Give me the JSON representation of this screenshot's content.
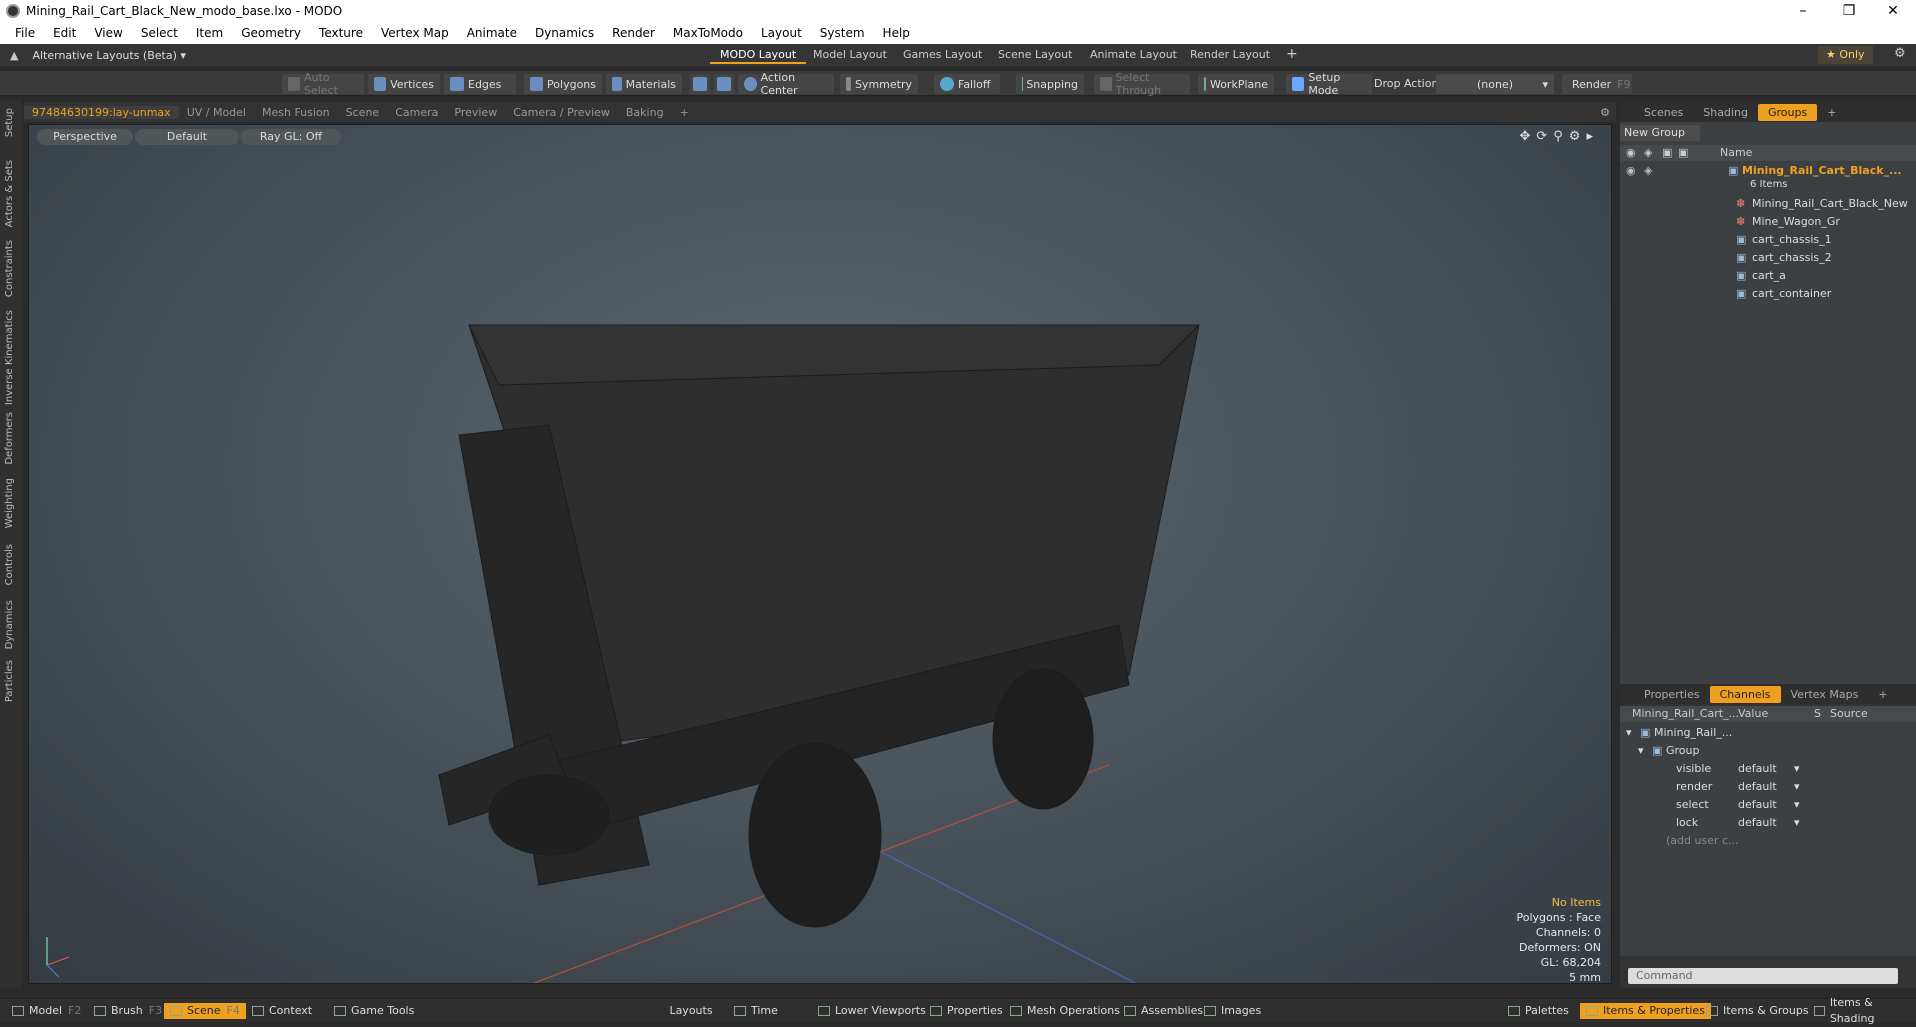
{
  "window": {
    "title": "Mining_Rail_Cart_Black_New_modo_base.lxo - MODO"
  },
  "menu": [
    "File",
    "Edit",
    "View",
    "Select",
    "Item",
    "Geometry",
    "Texture",
    "Vertex Map",
    "Animate",
    "Dynamics",
    "Render",
    "MaxToModo",
    "Layout",
    "System",
    "Help"
  ],
  "layouts": {
    "alt_label": "Alternative Layouts (Beta)",
    "tabs": [
      "MODO Layout",
      "Model Layout",
      "Games Layout",
      "Scene Layout",
      "Animate Layout",
      "Render Layout"
    ],
    "plus": "+",
    "only_label": "Only"
  },
  "toolbar": {
    "auto_select": "Auto Select",
    "vertices": "Vertices",
    "edges": "Edges",
    "polygons": "Polygons",
    "materials": "Materials",
    "action_center": "Action Center",
    "symmetry": "Symmetry",
    "falloff": "Falloff",
    "snapping": "Snapping",
    "select_through": "Select Through",
    "workplane": "WorkPlane",
    "setup_mode": "Setup Mode",
    "drop_action": "Drop Action",
    "drop_value": "(none)",
    "render": "Render",
    "render_key": "F9"
  },
  "left_tabs": [
    "Setup",
    "Actors & Sets",
    "Constraints",
    "Inverse Kinematics",
    "Deformers",
    "Weighting",
    "Controls",
    "Dynamics",
    "Particles"
  ],
  "viewport": {
    "tabs": [
      "97484630199:lay-unmax",
      "UV / Model",
      "Mesh Fusion",
      "Scene",
      "Camera",
      "Preview",
      "Camera / Preview",
      "Baking"
    ],
    "tab_plus": "+",
    "view_mode": "Perspective",
    "shading": "Default",
    "raygl": "Ray GL: Off",
    "info": {
      "no_items": "No Items",
      "polygons": "Polygons : Face",
      "channels": "Channels: 0",
      "deformers": "Deformers: ON",
      "gl": "GL: 68,204",
      "unit": "5 mm"
    }
  },
  "right_top": {
    "tabs": [
      "Scenes",
      "Shading",
      "Groups"
    ],
    "tab_plus": "+",
    "new_group": "New Group",
    "name_col": "Name",
    "group_name": "Mining_Rail_Cart_Black_...",
    "group_count": "6 Items",
    "items": [
      "Mining_Rail_Cart_Black_New",
      "Mine_Wagon_Gr",
      "cart_chassis_1",
      "cart_chassis_2",
      "cart_a",
      "cart_container"
    ]
  },
  "right_bottom": {
    "tabs": [
      "Properties",
      "Channels",
      "Vertex Maps"
    ],
    "tab_plus": "+",
    "cols": [
      "Mining_Rail_Cart_...",
      "Value",
      "S",
      "Source"
    ],
    "root": "Mining_Rail_...",
    "group": "Group",
    "channels": [
      {
        "name": "visible",
        "value": "default"
      },
      {
        "name": "render",
        "value": "default"
      },
      {
        "name": "select",
        "value": "default"
      },
      {
        "name": "lock",
        "value": "default"
      }
    ],
    "add_user": "(add user c...",
    "command_placeholder": "Command"
  },
  "bottom": {
    "left": [
      {
        "label": "Model",
        "key": "F2"
      },
      {
        "label": "Brush",
        "key": "F3"
      },
      {
        "label": "Scene",
        "key": "F4"
      },
      {
        "label": "Context",
        "key": ""
      },
      {
        "label": "Game Tools",
        "key": ""
      }
    ],
    "middle": [
      "Layouts",
      "Time",
      "Lower Viewports",
      "Properties",
      "Mesh Operations",
      "Assemblies",
      "Images"
    ],
    "right": [
      "Palettes",
      "Items & Properties",
      "Items & Groups",
      "Items & Shading"
    ]
  },
  "colors": {
    "accent": "#f0a020",
    "axis_x": "#c0503a",
    "axis_z": "#4a6ac0"
  }
}
